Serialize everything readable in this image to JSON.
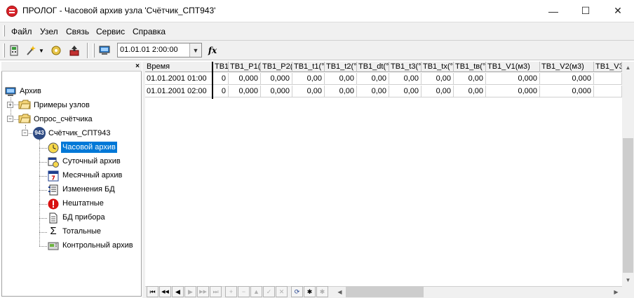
{
  "window": {
    "title": "ПРОЛОГ - Часовой архив узла 'Счётчик_СПТ943'",
    "minimize": "—",
    "maximize": "☐",
    "close": "✕"
  },
  "menu": [
    "Файл",
    "Узел",
    "Связь",
    "Сервис",
    "Справка"
  ],
  "toolbar": {
    "date_value": "01.01.01 2:00:00",
    "fx_label": "fx"
  },
  "left_panel": {
    "close": "×"
  },
  "tree": {
    "root": "Архив",
    "examples": "Примеры узлов",
    "poll": "Опрос_счётчика",
    "meter": "Счётчик_СПТ943",
    "meter_badge": "943",
    "archives": [
      {
        "label": "Часовой архив",
        "icon": "clock-icon"
      },
      {
        "label": "Суточный архив",
        "icon": "calendar-day-icon"
      },
      {
        "label": "Месячный архив",
        "icon": "calendar-month-icon"
      },
      {
        "label": "Изменения БД",
        "icon": "db-changes-icon"
      },
      {
        "label": "Нештатные",
        "icon": "alert-icon"
      },
      {
        "label": "БД прибора",
        "icon": "document-icon"
      },
      {
        "label": "Тотальные",
        "icon": "sigma-icon"
      },
      {
        "label": "Контрольный архив",
        "icon": "control-archive-icon"
      }
    ]
  },
  "grid": {
    "columns": [
      "Время",
      "ТВ1",
      "ТВ1_Р1(",
      "ТВ1_Р2(",
      "ТВ1_t1(°",
      "ТВ1_t2(°",
      "ТВ1_dt(°",
      "ТВ1_t3(°",
      "ТВ1_tx(°",
      "ТВ1_tв(°",
      "ТВ1_V1(м3)",
      "ТВ1_V2(м3)",
      "ТВ1_V3("
    ],
    "rows": [
      [
        "01.01.2001 01:00",
        "0",
        "0,000",
        "0,000",
        "0,00",
        "0,00",
        "0,00",
        "0,00",
        "0,00",
        "0,00",
        "0,000",
        "0,000",
        ""
      ],
      [
        "01.01.2001 02:00",
        "0",
        "0,000",
        "0,000",
        "0,00",
        "0,00",
        "0,00",
        "0,00",
        "0,00",
        "0,00",
        "0,000",
        "0,000",
        ""
      ]
    ]
  },
  "nav": {
    "first": "⏮",
    "prior_page": "◀◀",
    "prior": "◀",
    "next": "▶",
    "next_page": "▶▶",
    "last": "⏭",
    "insert": "+",
    "delete": "−",
    "edit": "▲",
    "post": "✓",
    "cancel": "✕",
    "refresh": "⟳",
    "apply": "✱",
    "clear": "✱"
  }
}
